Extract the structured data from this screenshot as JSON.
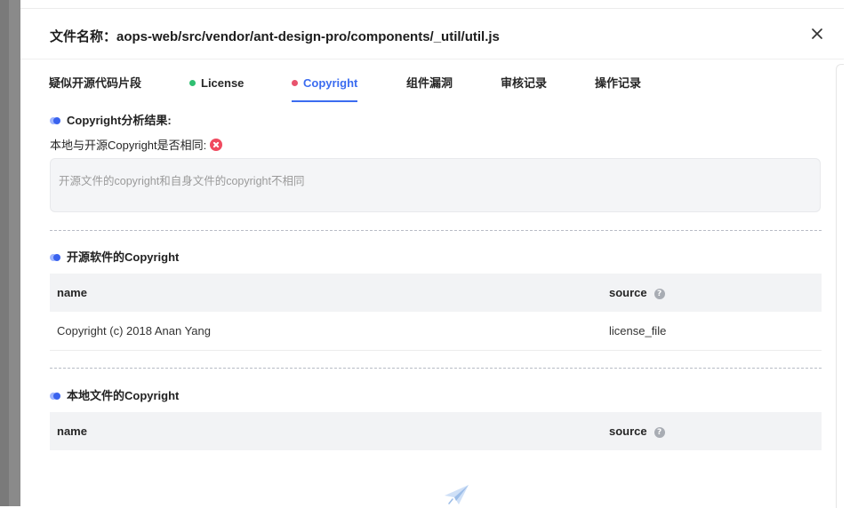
{
  "modal": {
    "title": "文件名称：aops-web/src/vendor/ant-design-pro/components/_util/util.js"
  },
  "tabs": [
    {
      "label": "疑似开源代码片段",
      "dot_color": null,
      "active": false
    },
    {
      "label": "License",
      "dot_color": "#2fbf71",
      "active": false
    },
    {
      "label": "Copyright",
      "dot_color": "#e8536d",
      "active": true
    },
    {
      "label": "组件漏洞",
      "dot_color": null,
      "active": false
    },
    {
      "label": "审核记录",
      "dot_color": null,
      "active": false
    },
    {
      "label": "操作记录",
      "dot_color": null,
      "active": false
    }
  ],
  "analysis": {
    "section_title": "Copyright分析结果:",
    "compare_label": "本地与开源Copyright是否相同:",
    "compare_status_icon": "error-circle-icon",
    "result_text": "开源文件的copyright和自身文件的copyright不相同"
  },
  "opensource_section": {
    "title": "开源软件的Copyright",
    "columns": {
      "name": "name",
      "source": "source"
    },
    "rows": [
      {
        "name": "Copyright (c) 2018 Anan Yang",
        "source": "license_file"
      }
    ]
  },
  "local_section": {
    "title": "本地文件的Copyright",
    "columns": {
      "name": "name",
      "source": "source"
    },
    "rows": []
  },
  "icons": {
    "help": "?",
    "empty_state": "paper-plane-icon",
    "close": "close-icon"
  },
  "colors": {
    "accent": "#3b6cf0",
    "license_dot": "#2fbf71",
    "copyright_dot": "#e8536d",
    "error": "#f04a5f"
  }
}
